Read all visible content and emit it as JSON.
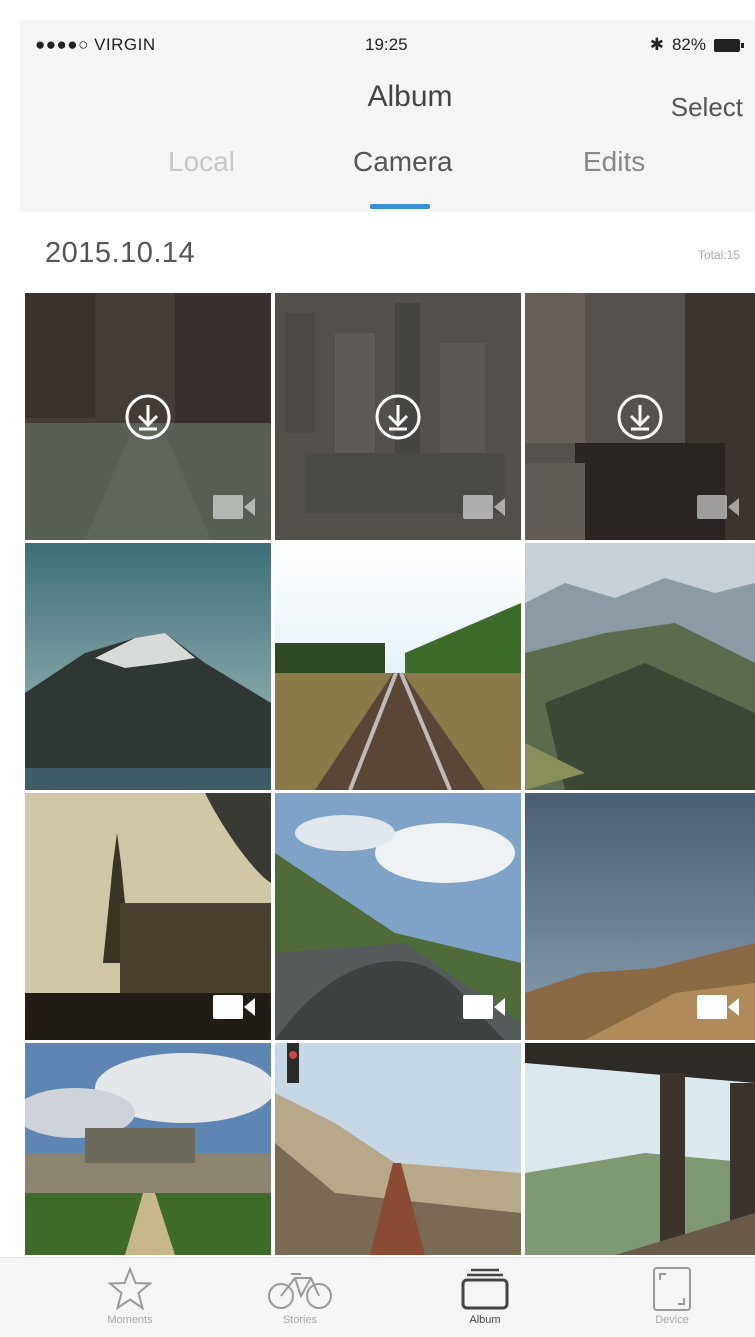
{
  "status_bar": {
    "carrier": "●●●●○ VIRGIN",
    "time": "19:25",
    "bluetooth": "✱",
    "battery": "82%"
  },
  "header": {
    "title": "Album",
    "select_label": "Select"
  },
  "tabs": [
    {
      "label": "Local",
      "active": false
    },
    {
      "label": "Camera",
      "active": true
    },
    {
      "label": "Edits",
      "active": false
    }
  ],
  "section": {
    "date": "2015.10.14",
    "total": "Total:15"
  },
  "photos": [
    {
      "scene": "forest-road",
      "type": "video",
      "downloadable": true
    },
    {
      "scene": "city-aerial",
      "type": "video",
      "downloadable": true
    },
    {
      "scene": "canal-town",
      "type": "video",
      "downloadable": true
    },
    {
      "scene": "snow-mountain",
      "type": "photo",
      "downloadable": false
    },
    {
      "scene": "railway-tracks",
      "type": "photo",
      "downloadable": false
    },
    {
      "scene": "mountain-valley",
      "type": "photo",
      "downloadable": false
    },
    {
      "scene": "eiffel-tower",
      "type": "video",
      "downloadable": false
    },
    {
      "scene": "mountain-road",
      "type": "video",
      "downloadable": false
    },
    {
      "scene": "desert-hills",
      "type": "video",
      "downloadable": false
    },
    {
      "scene": "chateau",
      "type": "photo",
      "downloadable": false
    },
    {
      "scene": "railway-signals",
      "type": "photo",
      "downloadable": false
    },
    {
      "scene": "pier-lake",
      "type": "photo",
      "downloadable": false
    }
  ],
  "tab_bar": [
    {
      "label": "Moments",
      "icon": "star-icon"
    },
    {
      "label": "Stories",
      "icon": "bicycle-icon"
    },
    {
      "label": "Album",
      "icon": "album-icon"
    },
    {
      "label": "Device",
      "icon": "device-icon"
    }
  ],
  "colors": {
    "accent": "#3b8fd8",
    "header_bg": "#f5f5f5"
  }
}
